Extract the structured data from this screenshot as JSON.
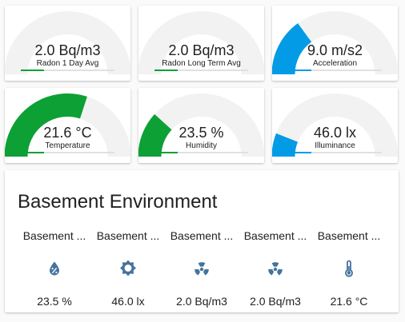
{
  "colors": {
    "blue": "#039be5",
    "green": "#0da035",
    "track": "#f2f2f2",
    "icon": "#44739e"
  },
  "gauges": [
    {
      "value": "2.0 Bq/m3",
      "label": "Radon 1 Day Avg",
      "fraction": 0.0,
      "color": "#0da035"
    },
    {
      "value": "2.0 Bq/m3",
      "label": "Radon Long Term Avg",
      "fraction": 0.0,
      "color": "#0da035"
    },
    {
      "value": "9.0 m/s2",
      "label": "Acceleration",
      "fraction": 0.3,
      "color": "#039be5"
    },
    {
      "value": "21.6 °C",
      "label": "Temperature",
      "fraction": 0.6,
      "color": "#0da035"
    },
    {
      "value": "23.5 %",
      "label": "Humidity",
      "fraction": 0.235,
      "color": "#0da035"
    },
    {
      "value": "46.0 lx",
      "label": "Illuminance",
      "fraction": 0.12,
      "color": "#039be5"
    }
  ],
  "panel": {
    "title": "Basement Environment",
    "entities": [
      {
        "name": "Basement ...",
        "icon": "water-percent-icon",
        "state": "23.5 %"
      },
      {
        "name": "Basement ...",
        "icon": "brightness-icon",
        "state": "46.0 lx"
      },
      {
        "name": "Basement ...",
        "icon": "radioactive-icon",
        "state": "2.0 Bq/m3"
      },
      {
        "name": "Basement ...",
        "icon": "radioactive-icon",
        "state": "2.0 Bq/m3"
      },
      {
        "name": "Basement ...",
        "icon": "thermometer-icon",
        "state": "21.6 °C"
      }
    ]
  }
}
